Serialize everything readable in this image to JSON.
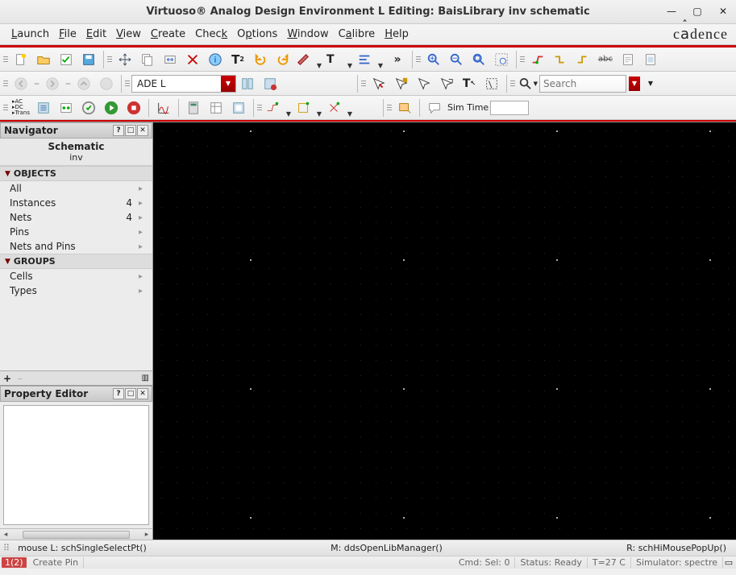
{
  "title": "Virtuoso® Analog Design Environment L Editing: BaisLibrary inv schematic",
  "brand": "cādence",
  "menus": [
    "Launch",
    "File",
    "Edit",
    "View",
    "Create",
    "Check",
    "Options",
    "Window",
    "Calibre",
    "Help"
  ],
  "combo_value": "ADE L",
  "search_placeholder": "Search",
  "sim_label": "Sim Time",
  "navigator": {
    "title": "Navigator",
    "subject": "Schematic",
    "cell": "inv",
    "groups": [
      {
        "name": "OBJECTS",
        "items": [
          {
            "label": "All",
            "count": ""
          },
          {
            "label": "Instances",
            "count": "4"
          },
          {
            "label": "Nets",
            "count": "4"
          },
          {
            "label": "Pins",
            "count": ""
          },
          {
            "label": "Nets and Pins",
            "count": ""
          }
        ]
      },
      {
        "name": "GROUPS",
        "items": [
          {
            "label": "Cells",
            "count": ""
          },
          {
            "label": "Types",
            "count": ""
          }
        ]
      }
    ]
  },
  "property_editor_title": "Property Editor",
  "status": {
    "left": "mouse L: schSingleSelectPt()",
    "mid": "M: ddsOpenLibManager()",
    "right": "R: schHiMousePopUp()"
  },
  "status2": {
    "page": "1(2)",
    "hint": "Create Pin",
    "cmd": "Cmd:  Sel: 0",
    "status": "Status: Ready",
    "temp": "T=27 C",
    "sim": "Simulator: spectre"
  }
}
